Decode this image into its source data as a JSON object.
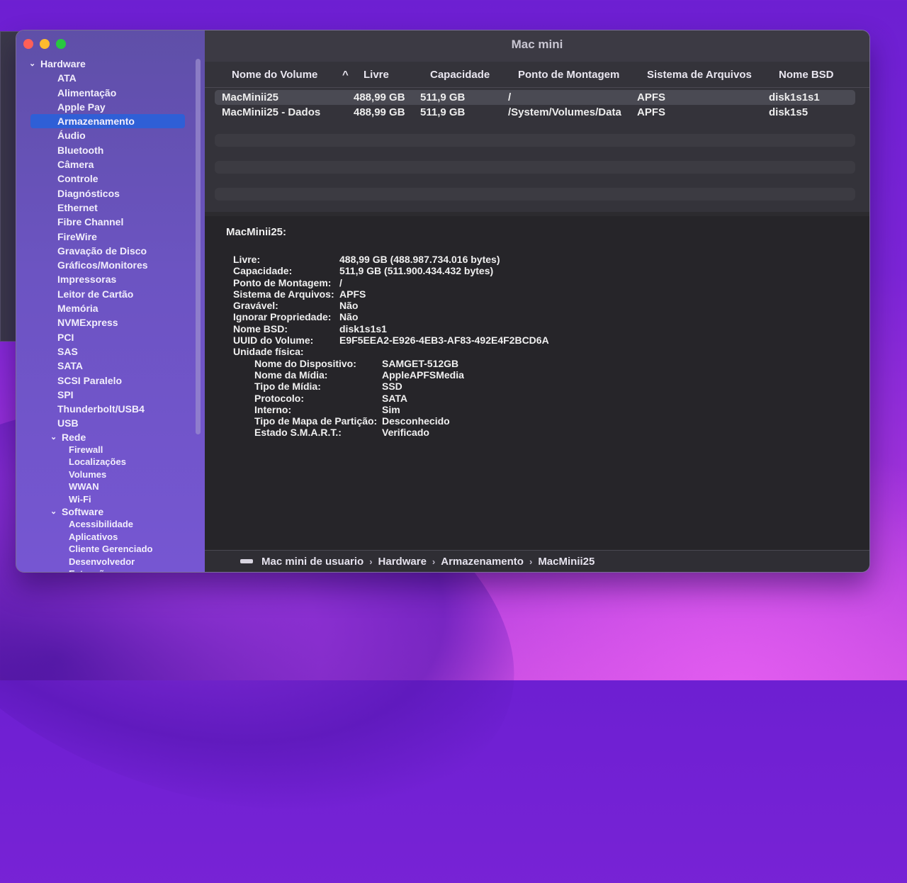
{
  "window": {
    "title": "Mac mini"
  },
  "sidebar": {
    "hardware_label": "Hardware",
    "hardware_items": [
      "ATA",
      "Alimentação",
      "Apple Pay",
      "Armazenamento",
      "Áudio",
      "Bluetooth",
      "Câmera",
      "Controle",
      "Diagnósticos",
      "Ethernet",
      "Fibre Channel",
      "FireWire",
      "Gravação de Disco",
      "Gráficos/Monitores",
      "Impressoras",
      "Leitor de Cartão",
      "Memória",
      "NVMExpress",
      "PCI",
      "SAS",
      "SATA",
      "SCSI Paralelo",
      "SPI",
      "Thunderbolt/USB4",
      "USB"
    ],
    "selected_index": 3,
    "rede_label": "Rede",
    "rede_items": [
      "Firewall",
      "Localizações",
      "Volumes",
      "WWAN",
      "Wi-Fi"
    ],
    "software_label": "Software",
    "software_items": [
      "Acessibilidade",
      "Aplicativos",
      "Cliente Gerenciado",
      "Desenvolvedor",
      "Extensões"
    ]
  },
  "table": {
    "columns": [
      "Nome do Volume",
      "Livre",
      "Capacidade",
      "Ponto de Montagem",
      "Sistema de Arquivos",
      "Nome BSD"
    ],
    "sort_indicator": "^",
    "rows": [
      [
        "MacMinii25",
        "488,99 GB",
        "511,9 GB",
        "/",
        "APFS",
        "disk1s1s1"
      ],
      [
        "MacMinii25 - Dados",
        "488,99 GB",
        "511,9 GB",
        "/System/Volumes/Data",
        "APFS",
        "disk1s5"
      ]
    ]
  },
  "detail": {
    "title": "MacMinii25:",
    "fields": [
      {
        "k": "Livre:",
        "v": "488,99 GB (488.987.734.016 bytes)"
      },
      {
        "k": "Capacidade:",
        "v": "511,9 GB (511.900.434.432 bytes)"
      },
      {
        "k": "Ponto de Montagem:",
        "v": "/"
      },
      {
        "k": "Sistema de Arquivos:",
        "v": "APFS"
      },
      {
        "k": "Gravável:",
        "v": "Não"
      },
      {
        "k": "Ignorar Propriedade:",
        "v": "Não"
      },
      {
        "k": "Nome BSD:",
        "v": "disk1s1s1"
      },
      {
        "k": "UUID do Volume:",
        "v": "E9F5EEA2-E926-4EB3-AF83-492E4F2BCD6A"
      },
      {
        "k": "Unidade física:",
        "v": ""
      }
    ],
    "physical": [
      {
        "k": "Nome do Dispositivo:",
        "v": "SAMGET-512GB"
      },
      {
        "k": "Nome da Mídia:",
        "v": "AppleAPFSMedia"
      },
      {
        "k": "Tipo de Mídia:",
        "v": "SSD"
      },
      {
        "k": "Protocolo:",
        "v": "SATA"
      },
      {
        "k": "Interno:",
        "v": "Sim"
      },
      {
        "k": "Tipo de Mapa de Partição:",
        "v": "Desconhecido"
      },
      {
        "k": "Estado S.M.A.R.T.:",
        "v": "Verificado"
      }
    ]
  },
  "pathbar": {
    "items": [
      "Mac mini de usuario",
      "Hardware",
      "Armazenamento",
      "MacMinii25"
    ],
    "separator": "›"
  }
}
